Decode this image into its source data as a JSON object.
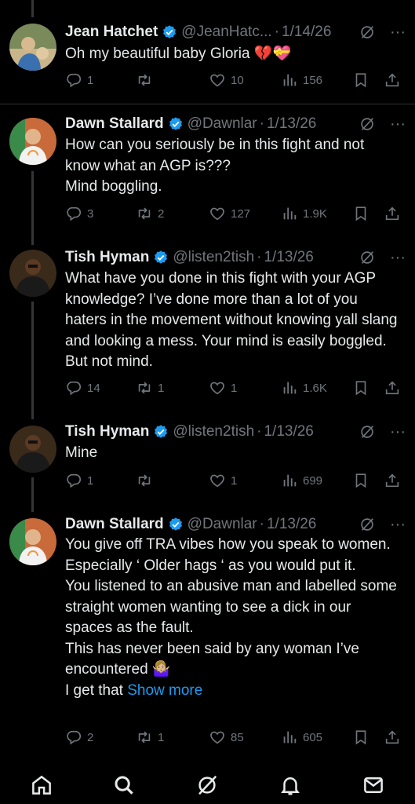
{
  "colors": {
    "background": "#000000",
    "text": "#e7e9ea",
    "muted": "#71767b",
    "link": "#1d9bf0",
    "verified": "#1d9bf0"
  },
  "tweets": [
    {
      "name": "Jean Hatchet",
      "handle": "@JeanHatc...",
      "date": "1/14/26",
      "body": [
        "Oh my beautiful baby Gloria 💔💝"
      ],
      "replies": "1",
      "reposts": "",
      "likes": "10",
      "views": "156"
    },
    {
      "name": "Dawn Stallard",
      "handle": "@Dawnlar",
      "date": "1/13/26",
      "body": [
        "How can you seriously be in this fight and not know what an AGP is???",
        "Mind boggling."
      ],
      "replies": "3",
      "reposts": "2",
      "likes": "127",
      "views": "1.9K"
    },
    {
      "name": "Tish Hyman",
      "handle": "@listen2tish",
      "date": "1/13/26",
      "body": [
        "What have you done in this fight with your AGP knowledge? I’ve done more than a lot of you haters in the movement without knowing yall slang and looking a mess. Your mind is easily boggled. But not mind."
      ],
      "replies": "14",
      "reposts": "1",
      "likes": "1",
      "views": "1.6K"
    },
    {
      "name": "Tish Hyman",
      "handle": "@listen2tish",
      "date": "1/13/26",
      "body": [
        "Mine"
      ],
      "replies": "1",
      "reposts": "",
      "likes": "1",
      "views": "699"
    },
    {
      "name": "Dawn Stallard",
      "handle": "@Dawnlar",
      "date": "1/13/26",
      "body": [
        "You give off TRA vibes how you speak to women. Especially ‘ Older hags ‘ as you would put it.",
        "You listened to an abusive man and labelled some straight women wanting to see a dick in our spaces as the fault.",
        "This has never been said by any woman I’ve encountered 🤷🏼‍♀️",
        "I get that"
      ],
      "show_more": "Show more",
      "replies": "2",
      "reposts": "1",
      "likes": "85",
      "views": "605"
    }
  ],
  "nav": [
    "home-icon",
    "search-icon",
    "grok-icon",
    "notifications-icon",
    "messages-icon"
  ]
}
